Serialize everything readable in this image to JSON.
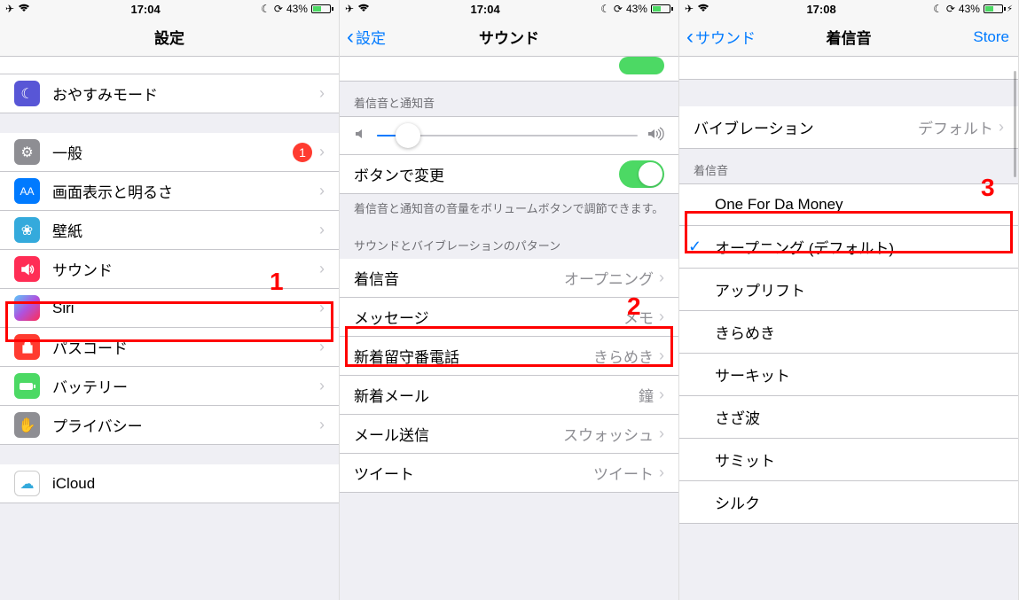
{
  "status": {
    "time1": "17:04",
    "time2": "17:04",
    "time3": "17:08",
    "battery_pct": "43%"
  },
  "screen1": {
    "title": "設定",
    "row_partial": "",
    "dnd": "おやすみモード",
    "general": "一般",
    "general_badge": "1",
    "display": "画面表示と明るさ",
    "wallpaper": "壁紙",
    "sounds": "サウンド",
    "siri": "Siri",
    "passcode": "パスコード",
    "battery": "バッテリー",
    "privacy": "プライバシー",
    "icloud": "iCloud",
    "annotation": "1"
  },
  "screen2": {
    "back": "設定",
    "title": "サウンド",
    "section1_header": "着信音と通知音",
    "button_change": "ボタンで変更",
    "footer": "着信音と通知音の音量をボリュームボタンで調節できます。",
    "section2_header": "サウンドとバイブレーションのパターン",
    "ringtone": "着信音",
    "ringtone_val": "オープニング",
    "message": "メッセージ",
    "message_val": "メモ",
    "voicemail": "新着留守番電話",
    "voicemail_val": "きらめき",
    "newmail": "新着メール",
    "newmail_val": "鐘",
    "sentmail": "メール送信",
    "sentmail_val": "スウォッシュ",
    "tweet": "ツイート",
    "tweet_val": "ツイート",
    "annotation": "2"
  },
  "screen3": {
    "back": "サウンド",
    "title": "着信音",
    "right": "Store",
    "vibration": "バイブレーション",
    "vibration_val": "デフォルト",
    "section_header": "着信音",
    "tones": [
      "One For Da Money",
      "オープニング (デフォルト)",
      "アップリフト",
      "きらめき",
      "サーキット",
      "さざ波",
      "サミット",
      "シルク"
    ],
    "selected_index": 1,
    "annotation": "3"
  }
}
